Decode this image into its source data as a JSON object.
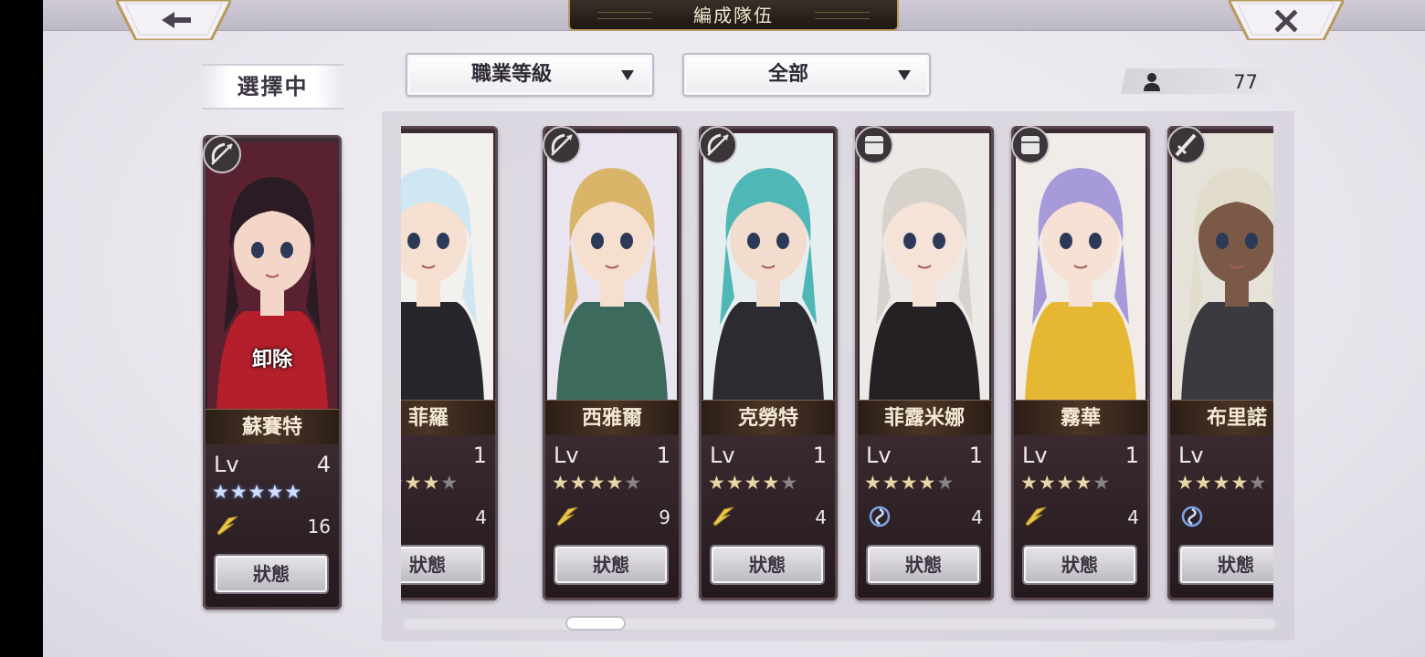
{
  "title": "編成隊伍",
  "nav": {
    "back_icon": "back-arrow-icon",
    "close_icon": "close-icon"
  },
  "selecting_label": "選擇中",
  "filters": [
    {
      "label": "職業等級"
    },
    {
      "label": "全部"
    }
  ],
  "unit_count": "77",
  "selected": {
    "name": "蘇賽特",
    "unequip_label": "卸除",
    "lv_label": "Lv",
    "level": "4",
    "stars": 5,
    "max_stars": 5,
    "star_style": "blue",
    "element": "lightning",
    "element_value": "16",
    "status_label": "狀態",
    "class": "archer",
    "palette": {
      "hair": "#2a1b25",
      "skin": "#f3d6c8",
      "outfit": "#b51f2b",
      "bg": "#5a2230"
    }
  },
  "roster": [
    {
      "name": "菲羅",
      "lv_label": "Lv",
      "level": "1",
      "stars": 4,
      "max_stars": 5,
      "element": "lightning",
      "element_value": "4",
      "status_label": "狀態",
      "class": "cavalry",
      "palette": {
        "hair": "#cfe7f2",
        "skin": "#f6e0d2",
        "outfit": "#26262c",
        "bg": "#f3f1ee"
      }
    },
    {
      "name": "西雅爾",
      "lv_label": "Lv",
      "level": "1",
      "stars": 4,
      "max_stars": 5,
      "element": "lightning",
      "element_value": "9",
      "status_label": "狀態",
      "class": "archer",
      "palette": {
        "hair": "#d9b56a",
        "skin": "#f6dfcf",
        "outfit": "#3c6b5e",
        "bg": "#e9e4f0"
      }
    },
    {
      "name": "克勞特",
      "lv_label": "Lv",
      "level": "1",
      "stars": 4,
      "max_stars": 5,
      "element": "lightning",
      "element_value": "4",
      "status_label": "狀態",
      "class": "archer",
      "palette": {
        "hair": "#4fb8b6",
        "skin": "#f2dccd",
        "outfit": "#2b2b31",
        "bg": "#e7eef0"
      }
    },
    {
      "name": "菲露米娜",
      "lv_label": "Lv",
      "level": "1",
      "stars": 4,
      "max_stars": 5,
      "element": "wind",
      "element_value": "4",
      "status_label": "狀態",
      "class": "armor",
      "palette": {
        "hair": "#d8d2cc",
        "skin": "#f5e3d8",
        "outfit": "#242024",
        "bg": "#ede9e6"
      }
    },
    {
      "name": "霧華",
      "lv_label": "Lv",
      "level": "1",
      "stars": 4,
      "max_stars": 5,
      "element": "lightning",
      "element_value": "4",
      "status_label": "狀態",
      "class": "armor",
      "palette": {
        "hair": "#a79ad8",
        "skin": "#f7e1d4",
        "outfit": "#e6b733",
        "bg": "#f2ece8"
      }
    },
    {
      "name": "布里諾",
      "lv_label": "Lv",
      "level": "",
      "stars": 4,
      "max_stars": 5,
      "element": "wind",
      "element_value": "",
      "status_label": "狀態",
      "class": "swordsman",
      "palette": {
        "hair": "#e2dccd",
        "skin": "#7a5a46",
        "outfit": "#3a3a40",
        "bg": "#e6e2da"
      }
    }
  ],
  "colors": {
    "accent": "#b89a5c",
    "card_bg": "#2b1e23",
    "star_on": "#e8d7a6",
    "star_off": "#8b8486"
  }
}
